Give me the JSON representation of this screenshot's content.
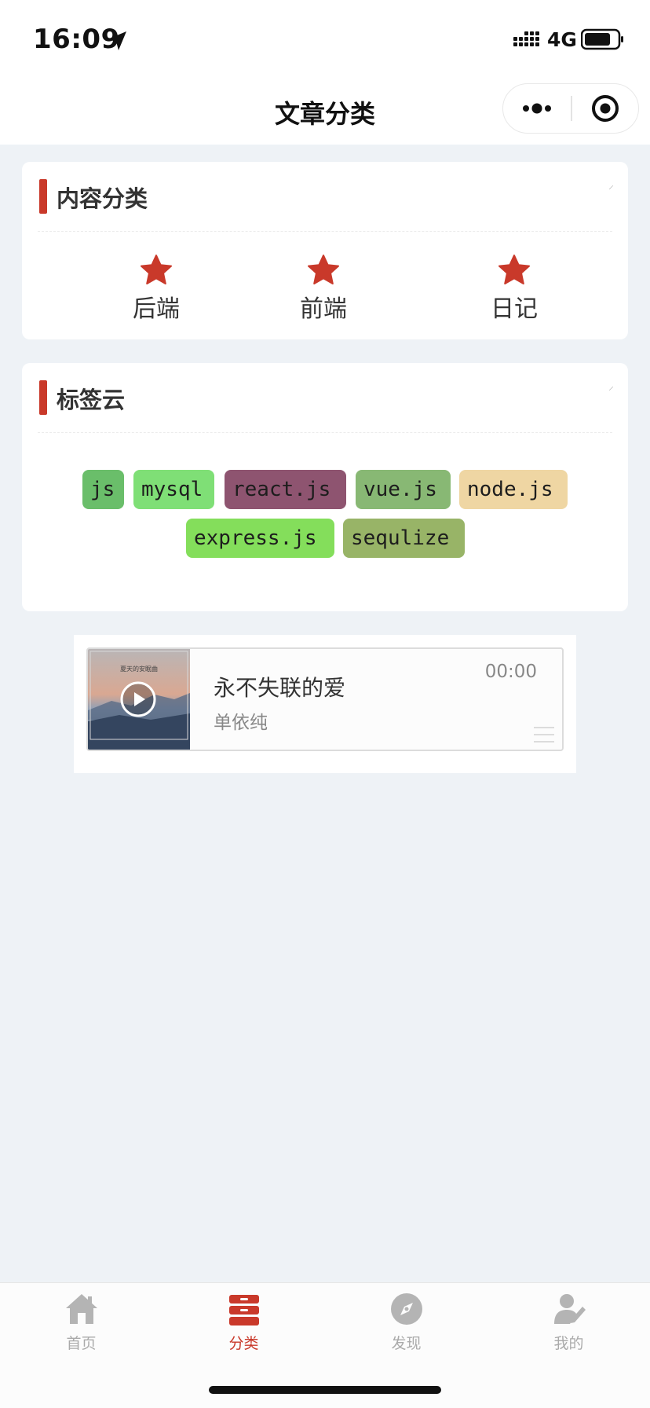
{
  "status_bar": {
    "time": "16:09",
    "network": "4G"
  },
  "nav": {
    "title": "文章分类"
  },
  "content_card": {
    "title": "内容分类",
    "categories": [
      {
        "label": "后端",
        "icon": "star-icon"
      },
      {
        "label": "前端",
        "icon": "star-icon"
      },
      {
        "label": "日记",
        "icon": "star-icon"
      }
    ]
  },
  "tag_card": {
    "title": "标签云",
    "tags": [
      {
        "label": "js",
        "color": "#6abe6a"
      },
      {
        "label": "mysql",
        "color": "#7fdf76"
      },
      {
        "label": "react.js",
        "color": "#8e5470"
      },
      {
        "label": "vue.js",
        "color": "#88b874"
      },
      {
        "label": "node.js",
        "color": "#efd6a3"
      },
      {
        "label": "express.js",
        "color": "#84de5b"
      },
      {
        "label": "sequlize",
        "color": "#98b467"
      }
    ]
  },
  "audio": {
    "name": "永不失联的爱",
    "author": "单依纯",
    "time": "00:00",
    "cover_caption": "夏天的安眠曲"
  },
  "tabbar": {
    "items": [
      {
        "label": "首页",
        "icon": "home-icon",
        "active": false
      },
      {
        "label": "分类",
        "icon": "category-icon",
        "active": true
      },
      {
        "label": "发现",
        "icon": "compass-icon",
        "active": false
      },
      {
        "label": "我的",
        "icon": "profile-icon",
        "active": false
      }
    ]
  },
  "colors": {
    "accent": "#c9392a",
    "inactive_tab": "#aaaaaa",
    "background": "#eef2f6"
  }
}
